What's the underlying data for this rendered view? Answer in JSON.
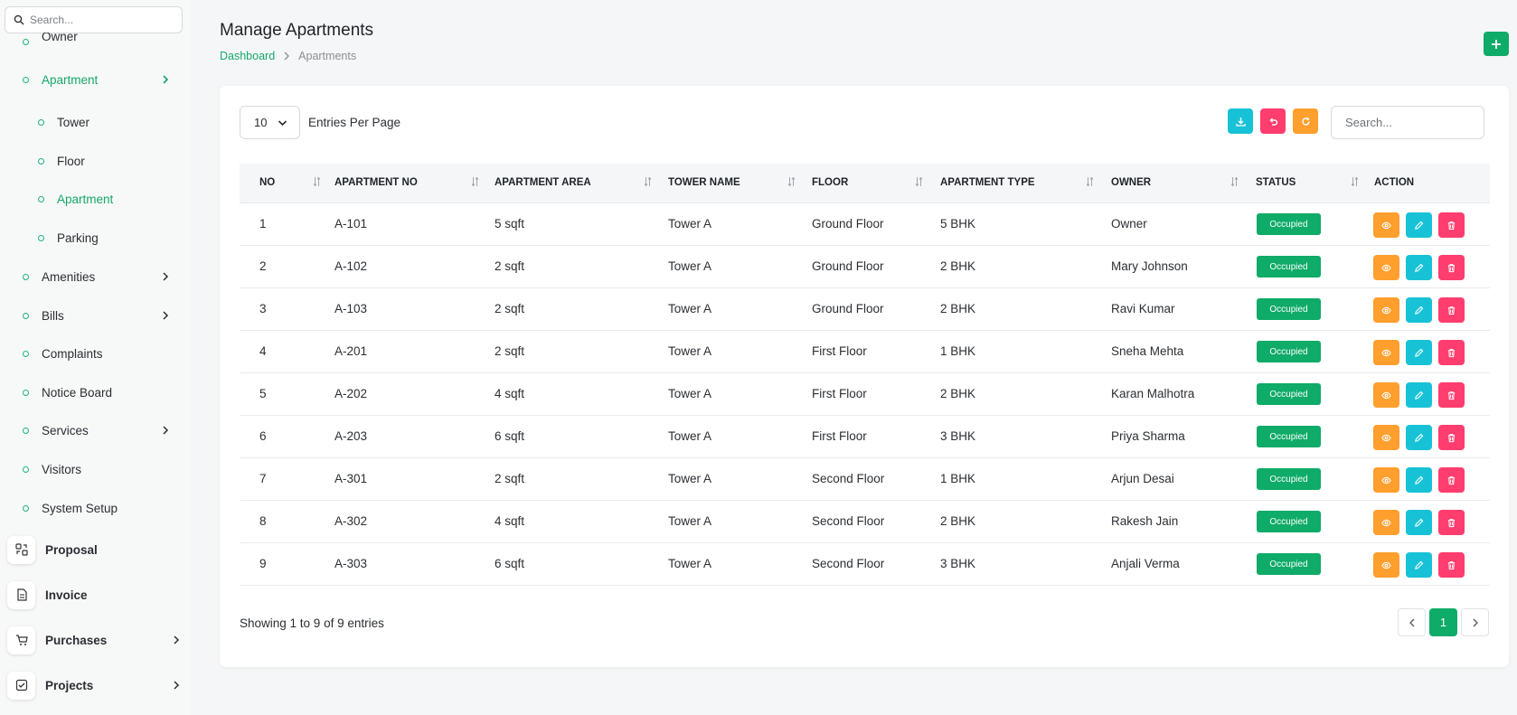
{
  "sidebar": {
    "search_placeholder": "Search...",
    "owner_label": "Owner",
    "apartment_group": {
      "label": "Apartment"
    },
    "submenu": [
      {
        "label": "Tower"
      },
      {
        "label": "Floor"
      },
      {
        "label": "Apartment",
        "active": true
      },
      {
        "label": "Parking"
      }
    ],
    "items": [
      {
        "label": "Amenities",
        "has_children": true
      },
      {
        "label": "Bills",
        "has_children": true
      },
      {
        "label": "Complaints",
        "has_children": false
      },
      {
        "label": "Notice Board",
        "has_children": false
      },
      {
        "label": "Services",
        "has_children": true
      },
      {
        "label": "Visitors",
        "has_children": false
      },
      {
        "label": "System Setup",
        "has_children": false
      }
    ],
    "groups": [
      {
        "label": "Proposal",
        "icon": "proposal-icon",
        "has_children": false
      },
      {
        "label": "Invoice",
        "icon": "invoice-icon",
        "has_children": false
      },
      {
        "label": "Purchases",
        "icon": "cart-icon",
        "has_children": true
      },
      {
        "label": "Projects",
        "icon": "checkbox-icon",
        "has_children": true
      }
    ]
  },
  "header": {
    "title": "Manage Apartments",
    "breadcrumb": {
      "link": "Dashboard",
      "current": "Apartments"
    },
    "add_icon": "plus-icon"
  },
  "controls": {
    "entries_value": "10",
    "entries_label": "Entries Per Page",
    "search_placeholder": "Search...",
    "tools": [
      "download-icon",
      "reset-icon",
      "refresh-icon"
    ]
  },
  "table": {
    "columns": [
      "NO",
      "APARTMENT NO",
      "APARTMENT AREA",
      "TOWER NAME",
      "FLOOR",
      "APARTMENT TYPE",
      "OWNER",
      "STATUS",
      "ACTION"
    ],
    "rows": [
      {
        "no": "1",
        "apartment_no": "A-101",
        "area": "5 sqft",
        "tower": "Tower A",
        "floor": "Ground Floor",
        "type": "5 BHK",
        "owner": "Owner",
        "status": "Occupied"
      },
      {
        "no": "2",
        "apartment_no": "A-102",
        "area": "2 sqft",
        "tower": "Tower A",
        "floor": "Ground Floor",
        "type": "2 BHK",
        "owner": "Mary Johnson",
        "status": "Occupied"
      },
      {
        "no": "3",
        "apartment_no": "A-103",
        "area": "2 sqft",
        "tower": "Tower A",
        "floor": "Ground Floor",
        "type": "2 BHK",
        "owner": "Ravi Kumar",
        "status": "Occupied"
      },
      {
        "no": "4",
        "apartment_no": "A-201",
        "area": "2 sqft",
        "tower": "Tower A",
        "floor": "First Floor",
        "type": "1 BHK",
        "owner": "Sneha Mehta",
        "status": "Occupied"
      },
      {
        "no": "5",
        "apartment_no": "A-202",
        "area": "4 sqft",
        "tower": "Tower A",
        "floor": "First Floor",
        "type": "2 BHK",
        "owner": "Karan Malhotra",
        "status": "Occupied"
      },
      {
        "no": "6",
        "apartment_no": "A-203",
        "area": "6 sqft",
        "tower": "Tower A",
        "floor": "First Floor",
        "type": "3 BHK",
        "owner": "Priya Sharma",
        "status": "Occupied"
      },
      {
        "no": "7",
        "apartment_no": "A-301",
        "area": "2 sqft",
        "tower": "Tower A",
        "floor": "Second Floor",
        "type": "1 BHK",
        "owner": "Arjun Desai",
        "status": "Occupied"
      },
      {
        "no": "8",
        "apartment_no": "A-302",
        "area": "4 sqft",
        "tower": "Tower A",
        "floor": "Second Floor",
        "type": "2 BHK",
        "owner": "Rakesh Jain",
        "status": "Occupied"
      },
      {
        "no": "9",
        "apartment_no": "A-303",
        "area": "6 sqft",
        "tower": "Tower A",
        "floor": "Second Floor",
        "type": "3 BHK",
        "owner": "Anjali Verma",
        "status": "Occupied"
      }
    ]
  },
  "footer": {
    "info": "Showing 1 to 9 of 9 entries",
    "current_page": "1"
  },
  "colors": {
    "accent": "#0fab68",
    "view": "#ff9f2e",
    "edit": "#18c2d6",
    "delete": "#ff3d6e"
  }
}
